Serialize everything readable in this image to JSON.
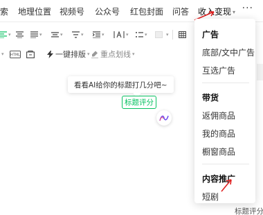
{
  "menubar": {
    "items": [
      {
        "label": "索",
        "active": false
      },
      {
        "label": "地理位置",
        "active": false
      },
      {
        "label": "视频号",
        "active": false
      },
      {
        "label": "公众号",
        "active": false
      },
      {
        "label": "红包封面",
        "active": false
      },
      {
        "label": "问答",
        "active": false
      },
      {
        "label": "收入变现",
        "active": true
      }
    ],
    "more_label": "···"
  },
  "toolbar": {
    "one_click_layout_label": "一键排版",
    "highlight_label": "重点划线"
  },
  "ai": {
    "tip_text": "看看AI给你的标题打几分吧~",
    "score_button_label": "标题评分"
  },
  "monetize_dropdown": {
    "sections": [
      {
        "header": "广告",
        "items": [
          "底部/文中广告",
          "互选广告"
        ]
      },
      {
        "header": "带货",
        "items": [
          "返佣商品",
          "我的商品",
          "橱窗商品"
        ]
      },
      {
        "header": "内容推广",
        "items": [
          "短剧"
        ]
      }
    ]
  },
  "bottom_right_label": "标题评分",
  "colors": {
    "accent_green": "#07c160",
    "annotation_red": "#e02020"
  }
}
